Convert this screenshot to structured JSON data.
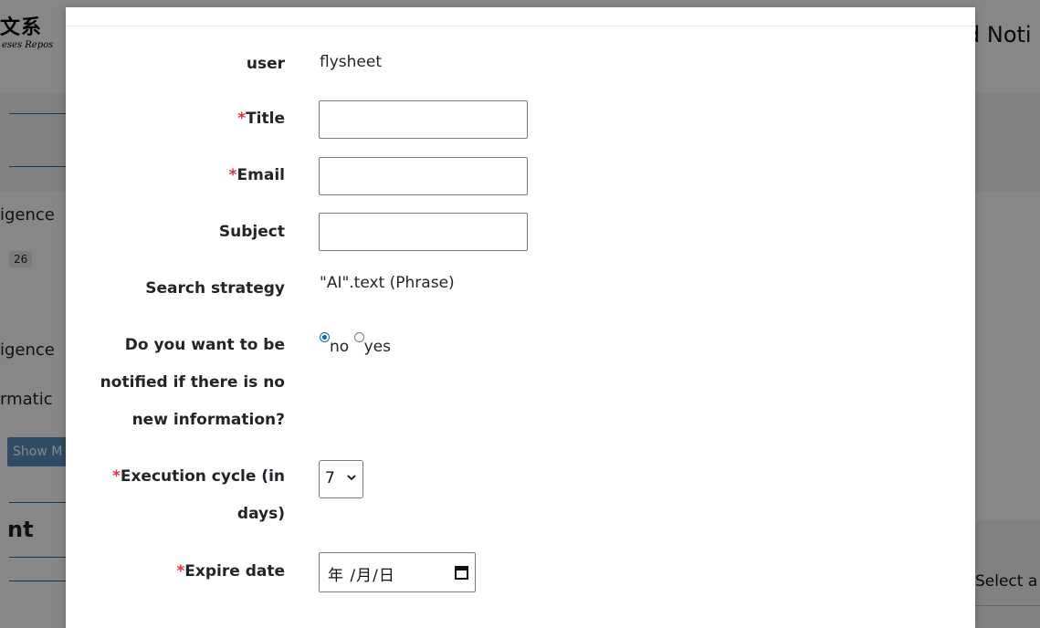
{
  "background": {
    "logo_cjk": "文系",
    "logo_en": "eses Repos",
    "right_title": "d Noti",
    "left_text_1": "igence",
    "count": "26",
    "left_text_2": "igence",
    "left_text_3": "rmatic",
    "show_button": "Show M",
    "heading": "nt",
    "right_select": "Select a"
  },
  "form": {
    "user_label": "user",
    "user_value": "flysheet",
    "title_label": "Title",
    "email_label": "Email",
    "subject_label": "Subject",
    "strategy_label": "Search strategy",
    "strategy_value": "\"AI\".text (Phrase)",
    "notify_label_line1": "Do you want to be",
    "notify_label_line2": "notified if there is no",
    "notify_label_line3": "new information?",
    "notify_options": [
      {
        "label": "no",
        "checked": true
      },
      {
        "label": "yes",
        "checked": false
      }
    ],
    "cycle_label_line1": "Execution cycle (in",
    "cycle_label_line2": "days)",
    "cycle_value": "7",
    "expire_label": "Expire date",
    "expire_placeholder": "年 /月/日",
    "required_mark": "*"
  },
  "colors": {
    "required": "#dc3545",
    "radio_accent": "#0b63ce",
    "rule_blue": "#2a6aa8"
  },
  "icons": {
    "select_chevron": "chevron-down-icon",
    "date_picker": "calendar-icon"
  }
}
